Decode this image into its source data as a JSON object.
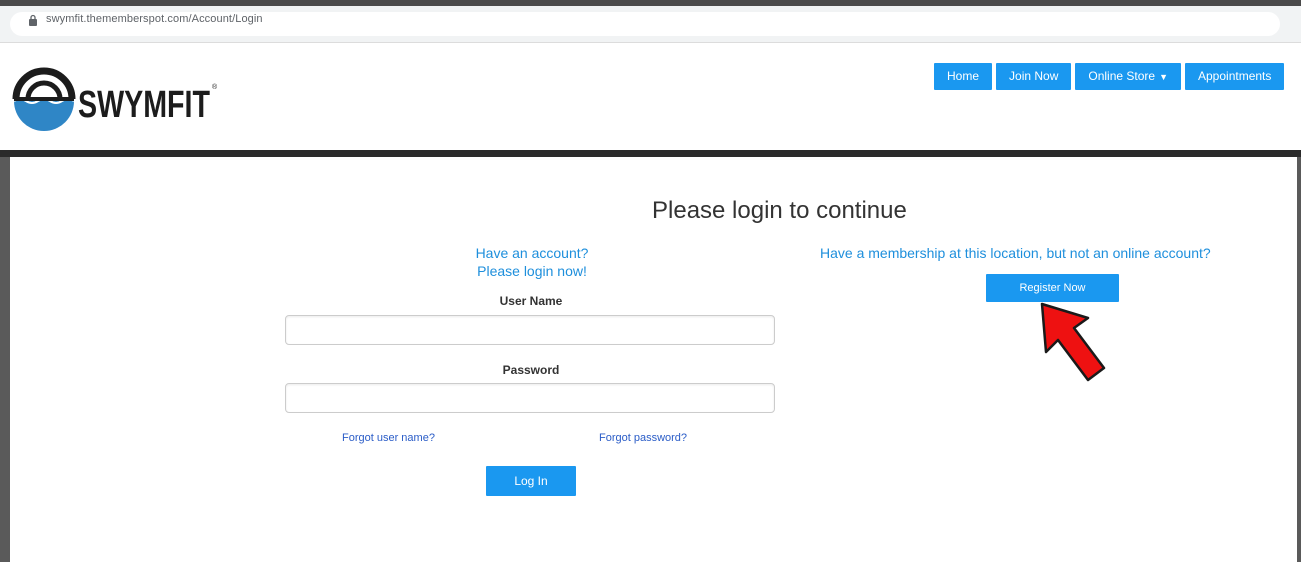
{
  "browser": {
    "url": "swymfit.thememberspot.com/Account/Login",
    "lock_icon": "lock-icon"
  },
  "header": {
    "logo_text": "SWYMFIT",
    "nav": [
      {
        "label": "Home"
      },
      {
        "label": "Join Now"
      },
      {
        "label": "Online Store",
        "has_dropdown": true,
        "caret_icon": "caret-down-icon"
      },
      {
        "label": "Appointments"
      }
    ]
  },
  "login": {
    "title": "Please login to continue",
    "have_account_line1": "Have an account?",
    "have_account_line2": "Please login now!",
    "username_label": "User Name",
    "username_value": "",
    "password_label": "Password",
    "password_value": "",
    "forgot_username": "Forgot user name?",
    "forgot_password": "Forgot password?",
    "login_button": "Log In"
  },
  "register": {
    "prompt": "Have a membership at this location, but not an online account?",
    "button": "Register Now",
    "annotation_icon": "red-arrow-icon"
  },
  "colors": {
    "primary_button": "#1a98f0",
    "link_blue": "#1e8fdc",
    "link_dark_blue": "#2a5cc7",
    "header_rule": "#2b2b2b",
    "arrow_red": "#ee1111"
  }
}
